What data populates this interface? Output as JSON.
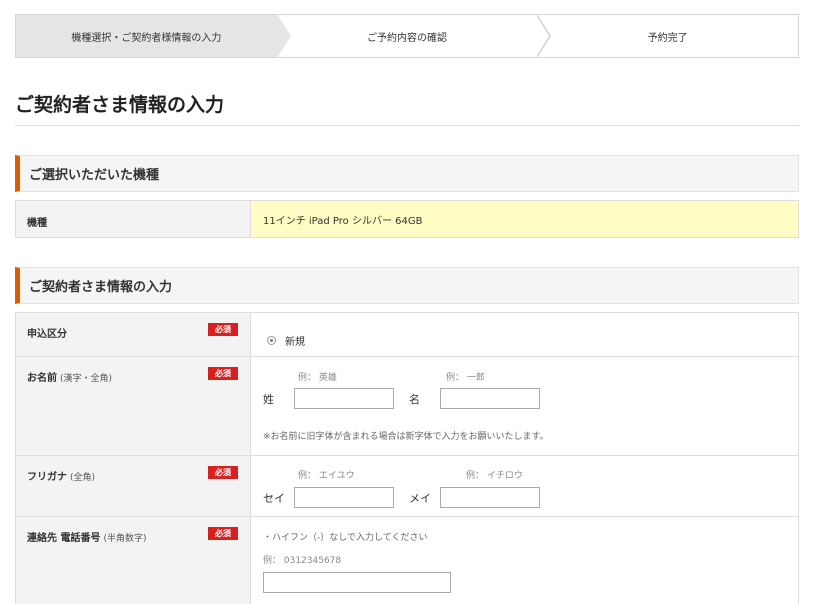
{
  "stepper": {
    "steps": [
      "機種選択・ご契約者様情報の入力",
      "ご予約内容の確認",
      "予約完了"
    ]
  },
  "page_title": "ご契約者さま情報の入力",
  "section_model": {
    "heading": "ご選択いただいた機種",
    "label": "機種",
    "value": "11インチ iPad Pro シルバー 64GB"
  },
  "section_contract": {
    "heading": "ご契約者さま情報の入力",
    "required_badge": "必須",
    "application": {
      "label": "申込区分",
      "option": "新規"
    },
    "name": {
      "label": "お名前",
      "sub": "(漢字・全角)",
      "last_label": "姓",
      "first_label": "名",
      "last_example": "例： 英雄",
      "first_example": "例： 一郎",
      "last_value": "",
      "first_value": "",
      "note": "※お名前に旧字体が含まれる場合は新字体で入力をお願いいたします。"
    },
    "kana": {
      "label": "フリガナ",
      "sub": "(全角)",
      "last_label": "セイ",
      "first_label": "メイ",
      "last_example": "例： エイユウ",
      "first_example": "例： イチロウ",
      "last_value": "",
      "first_value": ""
    },
    "tel": {
      "label": "連絡先 電話番号",
      "sub": "(半角数字)",
      "instruction": "・ハイフン（-）なしで入力してください",
      "example": "例： 0312345678",
      "value": ""
    }
  },
  "colors": {
    "accent": "#e05a00",
    "required": "#d92020",
    "highlight": "#fffdc4"
  }
}
